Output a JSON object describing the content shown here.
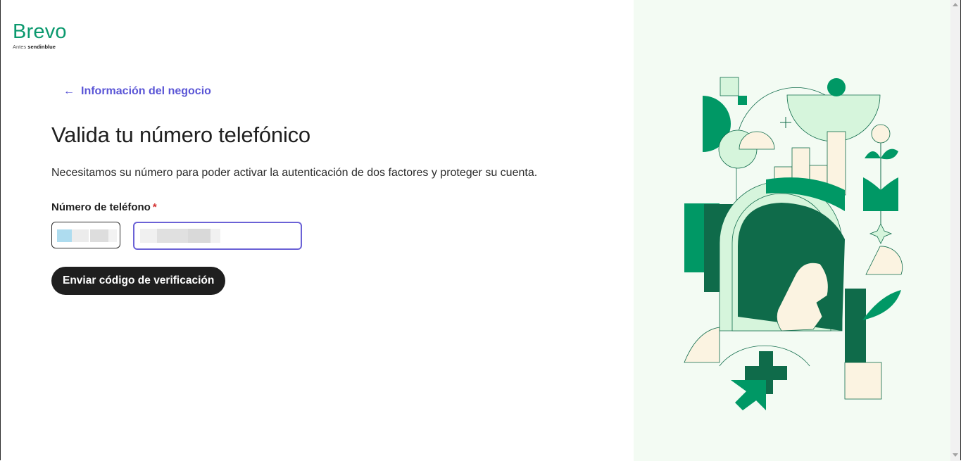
{
  "logo": {
    "name": "Brevo",
    "sub_muted": "Antes",
    "sub_bold": "sendinblue"
  },
  "back_link": {
    "icon": "arrow-left-icon",
    "label": "Información del negocio"
  },
  "page": {
    "title": "Valida tu número telefónico",
    "description": "Necesitamos su número para poder activar la autenticación de dos factores y proteger su cuenta."
  },
  "form": {
    "phone_label": "Número de teléfono",
    "required_marker": "*",
    "submit_label": "Enviar código de verificación"
  },
  "colors": {
    "brand_green": "#0b996e",
    "link_purple": "#5a55d6",
    "focus_border": "#6b62d6",
    "button_bg": "#1f1f1f",
    "illustration_bg": "#f3fbf3"
  }
}
